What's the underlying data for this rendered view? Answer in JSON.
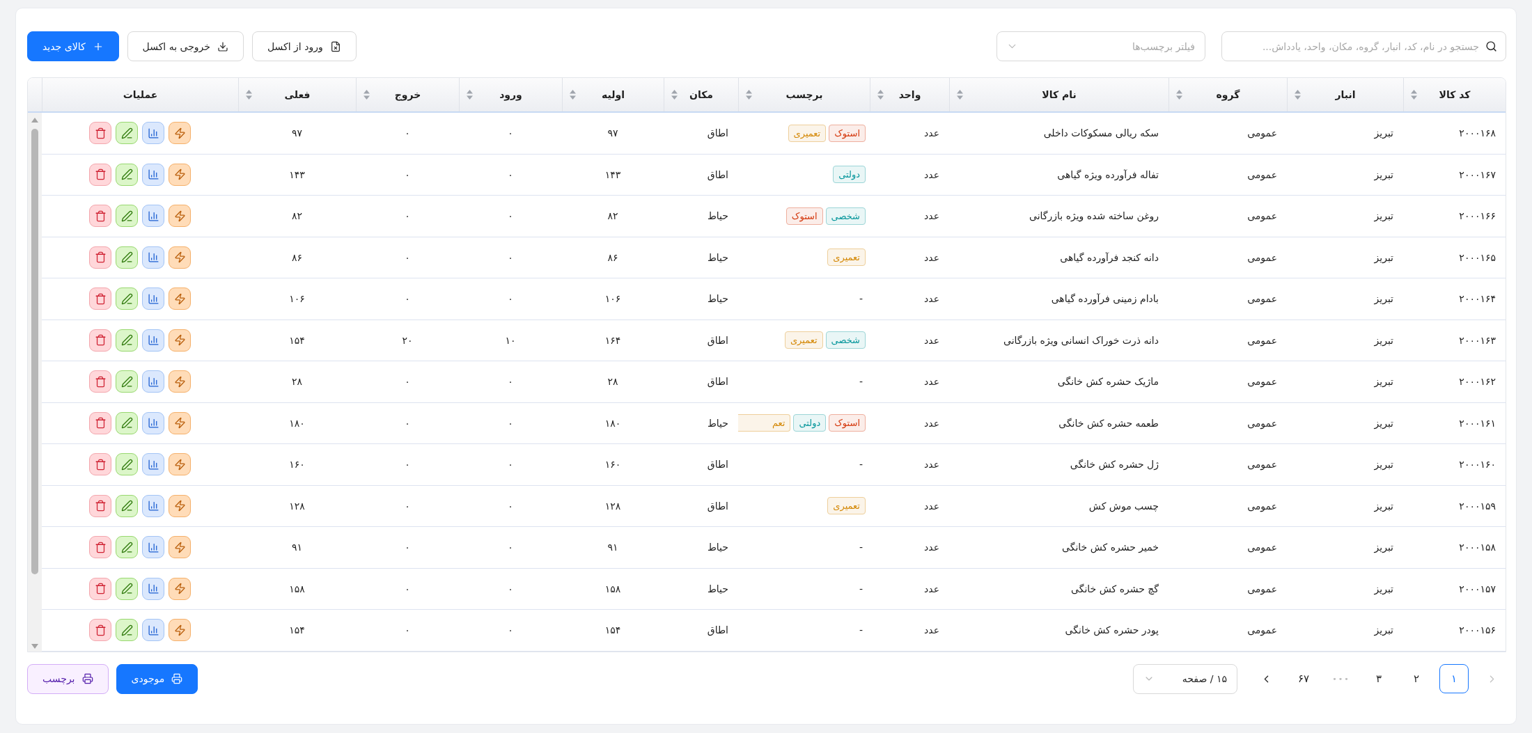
{
  "toolbar": {
    "search": {
      "placeholder": "جستجو در نام، کد، انبار، گروه، مکان، واحد، یادداش..."
    },
    "tag_filter": {
      "placeholder": "فیلتر برچسب‌ها"
    },
    "buttons": [
      {
        "label": "ورود از اکسل",
        "kind": "import"
      },
      {
        "label": "خروجی به اکسل",
        "kind": "export"
      },
      {
        "label": "کالای جدید",
        "kind": "create"
      }
    ]
  },
  "table": {
    "columns": [
      {
        "label": "کد کالا",
        "kind": "text",
        "sortable": true
      },
      {
        "label": "انبار",
        "kind": "text",
        "sortable": true
      },
      {
        "label": "گروه",
        "kind": "text",
        "sortable": true
      },
      {
        "label": "نام کالا",
        "kind": "text",
        "sortable": true
      },
      {
        "label": "واحد",
        "kind": "text",
        "sortable": true
      },
      {
        "label": "برچسب",
        "kind": "tags",
        "sortable": true
      },
      {
        "label": "مکان",
        "kind": "text",
        "sortable": true
      },
      {
        "label": "اولیه",
        "kind": "number",
        "sortable": true
      },
      {
        "label": "ورود",
        "kind": "number",
        "sortable": true
      },
      {
        "label": "خروج",
        "kind": "number",
        "sortable": true
      },
      {
        "label": "فعلی",
        "kind": "number",
        "sortable": true
      },
      {
        "label": "عملیات",
        "kind": "actions",
        "sortable": false
      }
    ],
    "rows": [
      {
        "cells": [
          "۲۰۰۰۱۶۸",
          "تبریز",
          "عمومی",
          "سکه ریالی مسکوکات داخلی",
          "عدد",
          "",
          "اطاق",
          "۹۷",
          "۰",
          "۰",
          "۹۷"
        ],
        "tags": [
          {
            "label": "استوک",
            "color": "#d4380d",
            "cut": false
          },
          {
            "label": "تعمیری",
            "color": "#d48806",
            "cut": false
          }
        ]
      },
      {
        "cells": [
          "۲۰۰۰۱۶۷",
          "تبریز",
          "عمومی",
          "تفاله فرآورده ویژه گیاهی",
          "عدد",
          "",
          "اطاق",
          "۱۴۳",
          "۰",
          "۰",
          "۱۴۳"
        ],
        "tags": [
          {
            "label": "دولتی",
            "color": "#08979c",
            "cut": false
          }
        ]
      },
      {
        "cells": [
          "۲۰۰۰۱۶۶",
          "تبریز",
          "عمومی",
          "روغن ساخته شده ویژه بازرگانی",
          "عدد",
          "",
          "حیاط",
          "۸۲",
          "۰",
          "۰",
          "۸۲"
        ],
        "tags": [
          {
            "label": "شخصی",
            "color": "#08979c",
            "cut": false
          },
          {
            "label": "استوک",
            "color": "#d4380d",
            "cut": false
          }
        ]
      },
      {
        "cells": [
          "۲۰۰۰۱۶۵",
          "تبریز",
          "عمومی",
          "دانه کنجد فرآورده گیاهی",
          "عدد",
          "",
          "حیاط",
          "۸۶",
          "۰",
          "۰",
          "۸۶"
        ],
        "tags": [
          {
            "label": "تعمیری",
            "color": "#d48806",
            "cut": false
          }
        ]
      },
      {
        "cells": [
          "۲۰۰۰۱۶۴",
          "تبریز",
          "عمومی",
          "بادام زمینی فرآورده گیاهی",
          "عدد",
          "-",
          "حیاط",
          "۱۰۶",
          "۰",
          "۰",
          "۱۰۶"
        ]
      },
      {
        "cells": [
          "۲۰۰۰۱۶۳",
          "تبریز",
          "عمومی",
          "دانه ذرت خوراک انسانی ویژه بازرگانی",
          "عدد",
          "",
          "اطاق",
          "۱۶۴",
          "۱۰",
          "۲۰",
          "۱۵۴"
        ],
        "tags": [
          {
            "label": "شخصی",
            "color": "#08979c",
            "cut": false
          },
          {
            "label": "تعمیری",
            "color": "#d48806",
            "cut": false
          }
        ]
      },
      {
        "cells": [
          "۲۰۰۰۱۶۲",
          "تبریز",
          "عمومی",
          "ماژیک حشره کش خانگی",
          "عدد",
          "-",
          "اطاق",
          "۲۸",
          "۰",
          "۰",
          "۲۸"
        ]
      },
      {
        "cells": [
          "۲۰۰۰۱۶۱",
          "تبریز",
          "عمومی",
          "طعمه حشره کش خانگی",
          "عدد",
          "",
          "حیاط",
          "۱۸۰",
          "۰",
          "۰",
          "۱۸۰"
        ],
        "tags": [
          {
            "label": "استوک",
            "color": "#d4380d",
            "cut": false
          },
          {
            "label": "دولتی",
            "color": "#08979c",
            "cut": false
          },
          {
            "label": "تعم",
            "color": "#d48806",
            "cut": true
          }
        ]
      },
      {
        "cells": [
          "۲۰۰۰۱۶۰",
          "تبریز",
          "عمومی",
          "ژل حشره کش خانگی",
          "عدد",
          "-",
          "اطاق",
          "۱۶۰",
          "۰",
          "۰",
          "۱۶۰"
        ]
      },
      {
        "cells": [
          "۲۰۰۰۱۵۹",
          "تبریز",
          "عمومی",
          "چسب موش کش",
          "عدد",
          "",
          "اطاق",
          "۱۲۸",
          "۰",
          "۰",
          "۱۲۸"
        ],
        "tags": [
          {
            "label": "تعمیری",
            "color": "#d48806",
            "cut": false
          }
        ]
      },
      {
        "cells": [
          "۲۰۰۰۱۵۸",
          "تبریز",
          "عمومی",
          "خمیر حشره کش خانگی",
          "عدد",
          "-",
          "حیاط",
          "۹۱",
          "۰",
          "۰",
          "۹۱"
        ]
      },
      {
        "cells": [
          "۲۰۰۰۱۵۷",
          "تبریز",
          "عمومی",
          "گچ حشره کش خانگی",
          "عدد",
          "-",
          "حیاط",
          "۱۵۸",
          "۰",
          "۰",
          "۱۵۸"
        ]
      },
      {
        "cells": [
          "۲۰۰۰۱۵۶",
          "تبریز",
          "عمومی",
          "پودر حشره کش خانگی",
          "عدد",
          "-",
          "اطاق",
          "۱۵۴",
          "۰",
          "۰",
          "۱۵۴"
        ]
      }
    ]
  },
  "footer": {
    "pagination": {
      "prev": {
        "disabled": true
      },
      "pages": [
        {
          "label": "۱",
          "kind": "page",
          "selected": true
        },
        {
          "label": "۲",
          "kind": "page",
          "selected": false
        },
        {
          "label": "۳",
          "kind": "page",
          "selected": false
        },
        {
          "label": "•••",
          "kind": "ellipsis",
          "selected": false
        },
        {
          "label": "۶۷",
          "kind": "page",
          "selected": false
        }
      ],
      "next": {
        "disabled": false
      },
      "page_size": "۱۵ / صفحه"
    },
    "buttons": [
      {
        "label": "موجودی",
        "kind": "primary"
      },
      {
        "label": "برچسب",
        "kind": "secondary"
      }
    ]
  }
}
